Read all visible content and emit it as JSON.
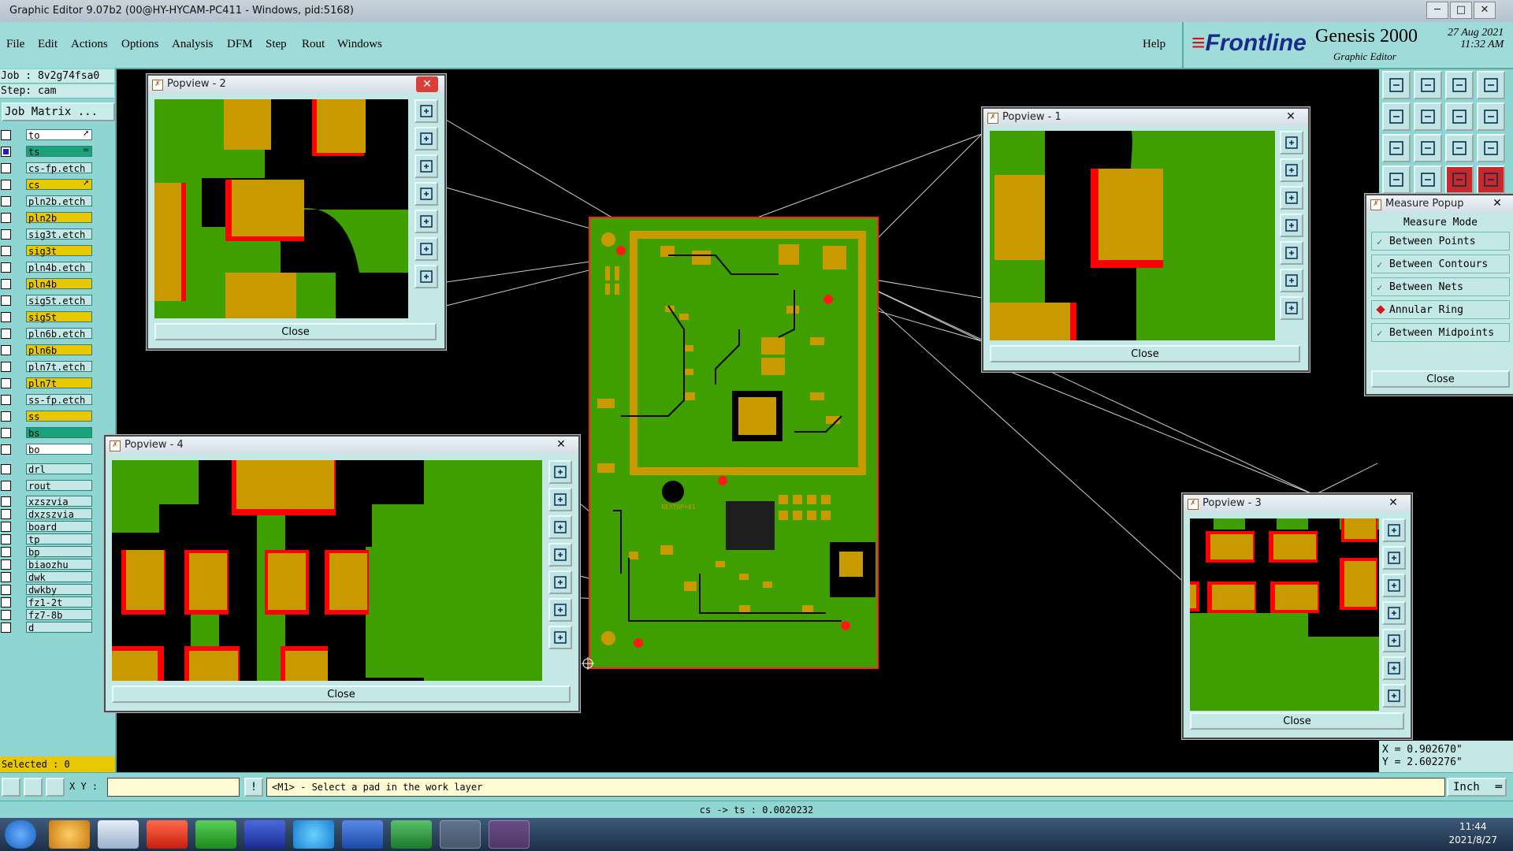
{
  "window": {
    "title": "Graphic Editor 9.07b2 (00@HY-HYCAM-PC411 - Windows, pid:5168)",
    "minimize": "─",
    "maximize": "□",
    "close": "✕"
  },
  "menu": [
    "File",
    "Edit",
    "Actions",
    "Options",
    "Analysis",
    "DFM",
    "Step",
    "Rout",
    "Windows"
  ],
  "help": "Help",
  "brand": {
    "logo": "Frontline",
    "product": "Genesis 2000",
    "subtitle": "Graphic Editor",
    "date": "27 Aug 2021",
    "time": "11:32 AM"
  },
  "left_panel": {
    "job": "Job : 8v2g74fsa0",
    "step": "Step: cam",
    "job_matrix": "Job Matrix ...",
    "selected": "Selected : 0",
    "layers": [
      {
        "name": "to",
        "color": "#ffffff",
        "checked": false,
        "mark": "➚"
      },
      {
        "name": "ts",
        "color": "#1aa37a",
        "checked": true,
        "mark": "="
      },
      {
        "name": "cs-fp.etch",
        "color": "#c4e8e6",
        "checked": false,
        "mark": ""
      },
      {
        "name": "cs",
        "color": "#e8c800",
        "checked": false,
        "mark": "➚"
      },
      {
        "name": "pln2b.etch",
        "color": "#c4e8e6",
        "checked": false,
        "mark": ""
      },
      {
        "name": "pln2b",
        "color": "#e8c800",
        "checked": false,
        "mark": ""
      },
      {
        "name": "sig3t.etch",
        "color": "#c4e8e6",
        "checked": false,
        "mark": ""
      },
      {
        "name": "sig3t",
        "color": "#e8c800",
        "checked": false,
        "mark": ""
      },
      {
        "name": "pln4b.etch",
        "color": "#c4e8e6",
        "checked": false,
        "mark": ""
      },
      {
        "name": "pln4b",
        "color": "#e8c800",
        "checked": false,
        "mark": ""
      },
      {
        "name": "sig5t.etch",
        "color": "#c4e8e6",
        "checked": false,
        "mark": ""
      },
      {
        "name": "sig5t",
        "color": "#e8c800",
        "checked": false,
        "mark": ""
      },
      {
        "name": "pln6b.etch",
        "color": "#c4e8e6",
        "checked": false,
        "mark": ""
      },
      {
        "name": "pln6b",
        "color": "#e8c800",
        "checked": false,
        "mark": ""
      },
      {
        "name": "pln7t.etch",
        "color": "#c4e8e6",
        "checked": false,
        "mark": ""
      },
      {
        "name": "pln7t",
        "color": "#e8c800",
        "checked": false,
        "mark": ""
      },
      {
        "name": "ss-fp.etch",
        "color": "#c4e8e6",
        "checked": false,
        "mark": ""
      },
      {
        "name": "ss",
        "color": "#e8c800",
        "checked": false,
        "mark": ""
      },
      {
        "name": "bs",
        "color": "#1aa37a",
        "checked": false,
        "mark": ""
      },
      {
        "name": "bo",
        "color": "#ffffff",
        "checked": false,
        "mark": ""
      },
      {
        "name": "drl",
        "color": "#c4e8e6",
        "checked": false,
        "mark": ""
      },
      {
        "name": "rout",
        "color": "#c4e8e6",
        "checked": false,
        "mark": ""
      },
      {
        "name": "xzszvia",
        "color": "#c4e8e6",
        "checked": false,
        "mark": ""
      },
      {
        "name": "dxzszvia",
        "color": "#c4e8e6",
        "checked": false,
        "mark": ""
      },
      {
        "name": "board",
        "color": "#c4e8e6",
        "checked": false,
        "mark": ""
      },
      {
        "name": "tp",
        "color": "#c4e8e6",
        "checked": false,
        "mark": ""
      },
      {
        "name": "bp",
        "color": "#c4e8e6",
        "checked": false,
        "mark": ""
      },
      {
        "name": "biaozhu",
        "color": "#c4e8e6",
        "checked": false,
        "mark": ""
      },
      {
        "name": "dwk",
        "color": "#c4e8e6",
        "checked": false,
        "mark": ""
      },
      {
        "name": "dwkby",
        "color": "#c4e8e6",
        "checked": false,
        "mark": ""
      },
      {
        "name": "fz1-2t",
        "color": "#c4e8e6",
        "checked": false,
        "mark": ""
      },
      {
        "name": "fz7-8b",
        "color": "#c4e8e6",
        "checked": false,
        "mark": ""
      },
      {
        "name": "d",
        "color": "#c4e8e6",
        "checked": false,
        "mark": ""
      }
    ]
  },
  "popviews": {
    "p1": {
      "title": "Popview - 1",
      "close": "Close",
      "x": "✕"
    },
    "p2": {
      "title": "Popview - 2",
      "close": "Close",
      "x": "✕"
    },
    "p3": {
      "title": "Popview - 3",
      "close": "Close",
      "x": "✕"
    },
    "p4": {
      "title": "Popview - 4",
      "close": "Close",
      "x": "✕"
    }
  },
  "measure": {
    "title": "Measure Popup",
    "x": "✕",
    "header": "Measure Mode",
    "options": [
      {
        "label": "Between Points",
        "selected": false
      },
      {
        "label": "Between Contours",
        "selected": false
      },
      {
        "label": "Between Nets",
        "selected": false
      },
      {
        "label": "Annular Ring",
        "selected": true
      },
      {
        "label": "Between Midpoints",
        "selected": false
      }
    ],
    "close": "Close"
  },
  "coords": {
    "x": "X = 0.902670\"",
    "y": "Y = 2.602276\""
  },
  "status": {
    "xy_label": "X Y :",
    "xy_value": "",
    "message": "<M1> - Select a pad in the work layer",
    "unit": "Inch",
    "info": "cs -> ts : 0.0020232"
  },
  "board_label": "BEXTOP+01",
  "taskbar": {
    "time": "11:44",
    "date": "2021/8/27"
  },
  "colors": {
    "copper": "#c89a00",
    "board": "#3f9e00",
    "mask": "#ff0a0a",
    "menu": "#9fdcd9"
  }
}
